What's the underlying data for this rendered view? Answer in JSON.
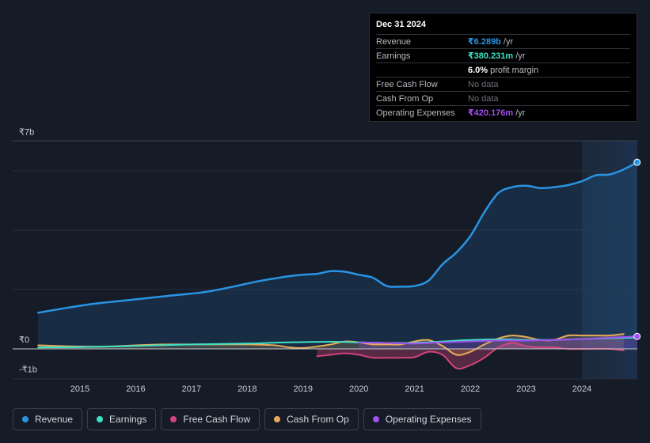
{
  "tooltip": {
    "date": "Dec 31 2024",
    "rows": [
      {
        "label": "Revenue",
        "value": "₹6.289b",
        "unit": "/yr",
        "color": "#2994e3"
      },
      {
        "label": "Earnings",
        "value": "₹380.231m",
        "unit": "/yr",
        "color": "#3fe1c5"
      },
      {
        "label": "",
        "value": "6.0%",
        "unit": "profit margin",
        "color": "#ffffff"
      },
      {
        "label": "Free Cash Flow",
        "value": "No data",
        "unit": "",
        "color": "#6b7079"
      },
      {
        "label": "Cash From Op",
        "value": "No data",
        "unit": "",
        "color": "#6b7079"
      },
      {
        "label": "Operating Expenses",
        "value": "₹420.176m",
        "unit": "/yr",
        "color": "#a04ff0"
      }
    ]
  },
  "legend": [
    {
      "label": "Revenue",
      "color": "#2994e3"
    },
    {
      "label": "Earnings",
      "color": "#3fe1c5"
    },
    {
      "label": "Free Cash Flow",
      "color": "#d1457c"
    },
    {
      "label": "Cash From Op",
      "color": "#e8aa5a"
    },
    {
      "label": "Operating Expenses",
      "color": "#a04ff0"
    }
  ],
  "chart_data": {
    "type": "line",
    "title": "",
    "xlabel": "",
    "ylabel": "",
    "currency": "₹",
    "ylim": [
      -1,
      7
    ],
    "y_tick_labels": [
      {
        "value": 7,
        "label": "₹7b"
      },
      {
        "value": 0,
        "label": "₹0"
      },
      {
        "value": -1,
        "label": "-₹1b"
      }
    ],
    "gridlines": [
      2,
      4,
      6
    ],
    "xlim": [
      2014.0,
      2025.0
    ],
    "x_tick_labels": [
      "2015",
      "2016",
      "2017",
      "2018",
      "2019",
      "2020",
      "2021",
      "2022",
      "2023",
      "2024"
    ],
    "x_ticks": [
      2015,
      2016,
      2017,
      2018,
      2019,
      2020,
      2021,
      2022,
      2023,
      2024
    ],
    "highlight_range": [
      2024.0,
      2025.0
    ],
    "units": "billions INR",
    "series": [
      {
        "name": "Revenue",
        "color": "#2994e3",
        "fill": true,
        "points": [
          [
            2014.25,
            1.22
          ],
          [
            2014.75,
            1.38
          ],
          [
            2015.25,
            1.52
          ],
          [
            2015.75,
            1.62
          ],
          [
            2016.25,
            1.72
          ],
          [
            2016.75,
            1.82
          ],
          [
            2017.25,
            1.92
          ],
          [
            2017.75,
            2.1
          ],
          [
            2018.25,
            2.3
          ],
          [
            2018.75,
            2.45
          ],
          [
            2019.0,
            2.5
          ],
          [
            2019.25,
            2.53
          ],
          [
            2019.5,
            2.62
          ],
          [
            2019.75,
            2.6
          ],
          [
            2020.0,
            2.5
          ],
          [
            2020.25,
            2.4
          ],
          [
            2020.5,
            2.12
          ],
          [
            2020.75,
            2.1
          ],
          [
            2021.0,
            2.12
          ],
          [
            2021.25,
            2.3
          ],
          [
            2021.5,
            2.85
          ],
          [
            2021.75,
            3.25
          ],
          [
            2022.0,
            3.8
          ],
          [
            2022.25,
            4.6
          ],
          [
            2022.5,
            5.25
          ],
          [
            2022.75,
            5.45
          ],
          [
            2023.0,
            5.5
          ],
          [
            2023.25,
            5.42
          ],
          [
            2023.5,
            5.45
          ],
          [
            2023.75,
            5.52
          ],
          [
            2024.0,
            5.65
          ],
          [
            2024.25,
            5.85
          ],
          [
            2024.5,
            5.88
          ],
          [
            2024.75,
            6.05
          ],
          [
            2024.99,
            6.289
          ]
        ]
      },
      {
        "name": "Earnings",
        "color": "#3fe1c5",
        "fill": false,
        "points": [
          [
            2014.25,
            0.05
          ],
          [
            2015.0,
            0.06
          ],
          [
            2016.0,
            0.1
          ],
          [
            2017.0,
            0.15
          ],
          [
            2018.0,
            0.18
          ],
          [
            2018.75,
            0.22
          ],
          [
            2019.5,
            0.24
          ],
          [
            2020.0,
            0.22
          ],
          [
            2020.5,
            0.2
          ],
          [
            2021.0,
            0.2
          ],
          [
            2021.5,
            0.25
          ],
          [
            2022.0,
            0.3
          ],
          [
            2022.5,
            0.32
          ],
          [
            2023.0,
            0.3
          ],
          [
            2023.5,
            0.3
          ],
          [
            2024.0,
            0.33
          ],
          [
            2024.5,
            0.36
          ],
          [
            2024.99,
            0.38
          ]
        ]
      },
      {
        "name": "Free Cash Flow",
        "color": "#d1457c",
        "fill": true,
        "points": [
          [
            2019.25,
            -0.25
          ],
          [
            2019.5,
            -0.2
          ],
          [
            2019.75,
            -0.15
          ],
          [
            2020.0,
            -0.2
          ],
          [
            2020.25,
            -0.3
          ],
          [
            2020.5,
            -0.3
          ],
          [
            2020.75,
            -0.3
          ],
          [
            2021.0,
            -0.28
          ],
          [
            2021.25,
            -0.1
          ],
          [
            2021.5,
            -0.2
          ],
          [
            2021.75,
            -0.65
          ],
          [
            2022.0,
            -0.55
          ],
          [
            2022.25,
            -0.3
          ],
          [
            2022.5,
            0.05
          ],
          [
            2022.75,
            0.2
          ],
          [
            2023.0,
            0.1
          ],
          [
            2023.25,
            0.05
          ],
          [
            2023.5,
            0.05
          ],
          [
            2023.75,
            0.0
          ],
          [
            2024.0,
            0.0
          ],
          [
            2024.25,
            0.0
          ],
          [
            2024.5,
            0.0
          ],
          [
            2024.75,
            -0.05
          ]
        ]
      },
      {
        "name": "Cash From Op",
        "color": "#e8aa5a",
        "fill": true,
        "points": [
          [
            2014.25,
            0.12
          ],
          [
            2015.0,
            0.08
          ],
          [
            2015.5,
            0.08
          ],
          [
            2016.0,
            0.12
          ],
          [
            2016.5,
            0.15
          ],
          [
            2017.0,
            0.15
          ],
          [
            2017.5,
            0.15
          ],
          [
            2018.0,
            0.15
          ],
          [
            2018.5,
            0.12
          ],
          [
            2018.75,
            0.05
          ],
          [
            2019.0,
            0.03
          ],
          [
            2019.25,
            0.08
          ],
          [
            2019.5,
            0.15
          ],
          [
            2019.75,
            0.25
          ],
          [
            2020.0,
            0.22
          ],
          [
            2020.25,
            0.15
          ],
          [
            2020.5,
            0.15
          ],
          [
            2020.75,
            0.15
          ],
          [
            2021.0,
            0.25
          ],
          [
            2021.25,
            0.3
          ],
          [
            2021.5,
            0.1
          ],
          [
            2021.75,
            -0.2
          ],
          [
            2022.0,
            -0.1
          ],
          [
            2022.25,
            0.15
          ],
          [
            2022.5,
            0.35
          ],
          [
            2022.75,
            0.45
          ],
          [
            2023.0,
            0.4
          ],
          [
            2023.25,
            0.3
          ],
          [
            2023.5,
            0.3
          ],
          [
            2023.75,
            0.45
          ],
          [
            2024.0,
            0.45
          ],
          [
            2024.25,
            0.45
          ],
          [
            2024.5,
            0.45
          ],
          [
            2024.75,
            0.5
          ]
        ]
      },
      {
        "name": "Operating Expenses",
        "color": "#a04ff0",
        "fill": true,
        "points": [
          [
            2020.0,
            0.22
          ],
          [
            2020.5,
            0.2
          ],
          [
            2021.0,
            0.18
          ],
          [
            2021.5,
            0.22
          ],
          [
            2022.0,
            0.25
          ],
          [
            2022.5,
            0.28
          ],
          [
            2023.0,
            0.28
          ],
          [
            2023.5,
            0.3
          ],
          [
            2024.0,
            0.33
          ],
          [
            2024.5,
            0.38
          ],
          [
            2024.99,
            0.42
          ]
        ]
      }
    ]
  }
}
